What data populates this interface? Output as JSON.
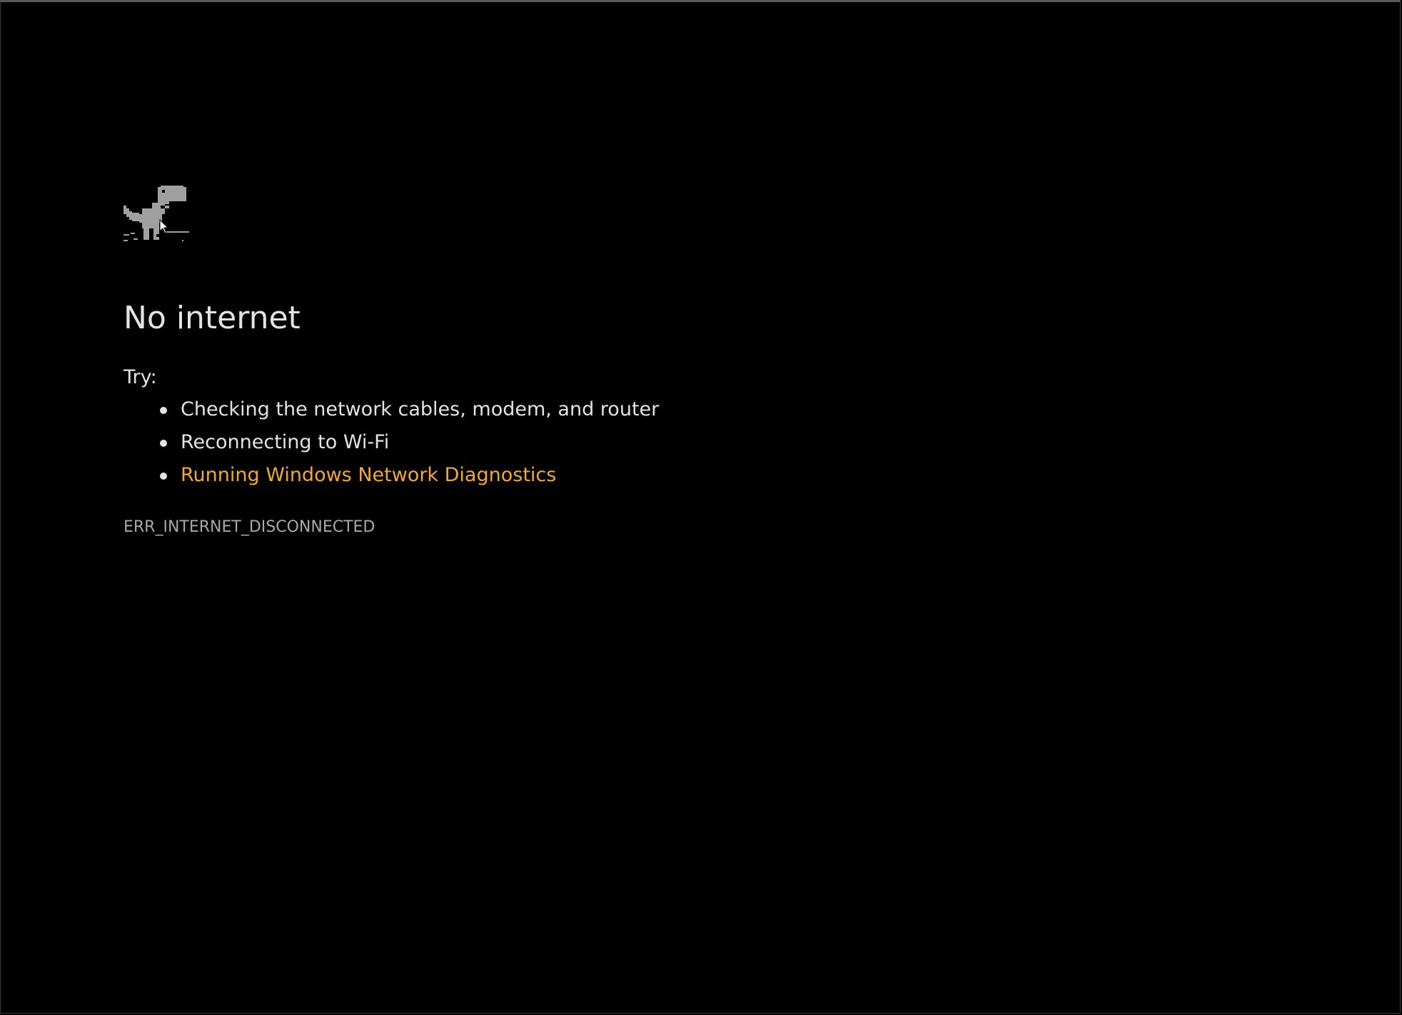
{
  "page": {
    "title": "No internet",
    "try_label": "Try:",
    "suggestions": [
      {
        "text": "Checking the network cables, modem, and router",
        "is_link": false
      },
      {
        "text": "Reconnecting to Wi-Fi",
        "is_link": false
      },
      {
        "text": "Running Windows Network Diagnostics",
        "is_link": true
      }
    ],
    "error_code": "ERR_INTERNET_DISCONNECTED"
  },
  "icons": {
    "illustration": "offline-dinosaur-icon",
    "pointer": "mouse-cursor-icon"
  },
  "colors": {
    "background": "#000000",
    "text": "#e3e3e3",
    "link": "#f2a932",
    "error_code": "#a8a8a8",
    "dino": "#a0a0a0"
  }
}
